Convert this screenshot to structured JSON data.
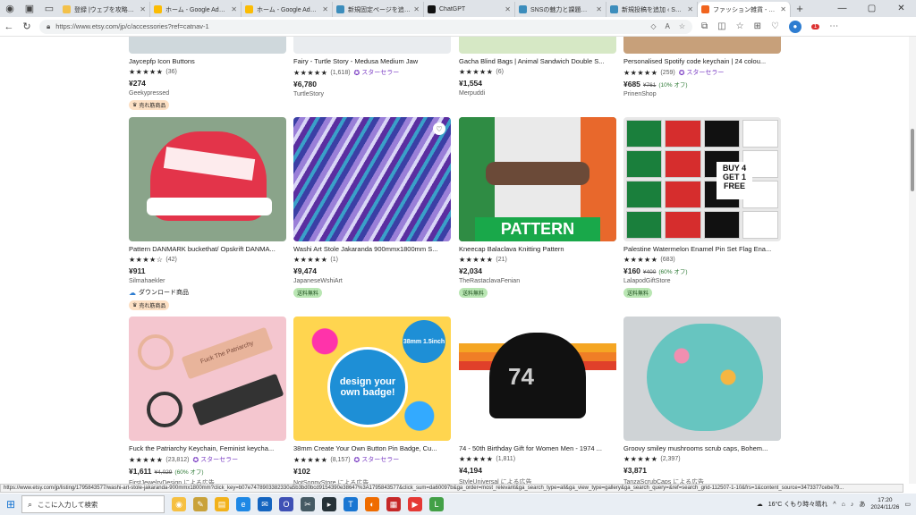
{
  "browser": {
    "tabs": [
      {
        "title": "登録 |ウェブを攻略するためのアイデア",
        "color": "#f3c14a"
      },
      {
        "title": "ホーム - Google AdSense",
        "color": "#fbbc04"
      },
      {
        "title": "ホーム - Google AdSense",
        "color": "#fbbc04"
      },
      {
        "title": "新規固定ページを追加 ‹ SNSの",
        "color": "#3c8dbc"
      },
      {
        "title": "ChatGPT",
        "color": "#111"
      },
      {
        "title": "SNSの魅力と課題：私たちの",
        "color": "#3c8dbc"
      },
      {
        "title": "新規投稿を追加 ‹ SNSの魅力",
        "color": "#3c8dbc"
      },
      {
        "title": "ファッション雑貨 - Etsy 日本",
        "color": "#f1641e"
      }
    ],
    "url": "https://www.etsy.com/jp/c/accessories?ref=catnav-1",
    "avatar_badge": "1"
  },
  "products": [
    {
      "title": "Jaycepfp Icon Buttons",
      "stars": "★★★★★",
      "reviews": "(36)",
      "star_seller": "",
      "price": "¥274",
      "orig": "",
      "disc": "",
      "shop": "Geekypressed",
      "bestseller": "売れ筋商品",
      "download": "",
      "ship": "",
      "img": "#cfd8dc"
    },
    {
      "title": "Fairy - Turtle Story - Medusa Medium Jaw",
      "stars": "★★★★★",
      "reviews": "(1,618)",
      "star_seller": "スターセラー",
      "price": "¥6,780",
      "orig": "",
      "disc": "",
      "shop": "TurtleStory",
      "bestseller": "",
      "download": "",
      "ship": "",
      "img": "#e9ecef"
    },
    {
      "title": "Gacha Blind Bags | Animal Sandwich Double S...",
      "stars": "★★★★★",
      "reviews": "(6)",
      "star_seller": "",
      "price": "¥1,554",
      "orig": "",
      "disc": "",
      "shop": "Merpuddi",
      "bestseller": "",
      "download": "",
      "ship": "",
      "img": "#d6e8c5"
    },
    {
      "title": "Personalised Spotify code keychain | 24 colou...",
      "stars": "★★★★★",
      "reviews": "(259)",
      "star_seller": "スターセラー",
      "price": "¥685",
      "orig": "¥761",
      "disc": "(10% オフ)",
      "shop": "PrinenShop",
      "bestseller": "",
      "download": "",
      "ship": "",
      "img": "#c7a07a"
    },
    {
      "title": "Pattern DANMARK buckethat/ Opskrift DANMA...",
      "stars": "★★★★☆",
      "reviews": "(42)",
      "star_seller": "",
      "price": "¥911",
      "orig": "",
      "disc": "",
      "shop": "Silmahaekler",
      "bestseller": "売れ筋商品",
      "download": "ダウンロード商品",
      "ship": "",
      "img": "danmark"
    },
    {
      "title": "Washi Art Stole Jakaranda 900mmx1800mm S...",
      "stars": "★★★★★",
      "reviews": "(1)",
      "star_seller": "",
      "price": "¥9,474",
      "orig": "",
      "disc": "",
      "shop": "JapaneseWshiArt",
      "bestseller": "",
      "download": "",
      "ship": "送料無料",
      "img": "washi"
    },
    {
      "title": "Kneecap Balaclava Knitting Pattern",
      "stars": "★★★★★",
      "reviews": "(21)",
      "star_seller": "",
      "price": "¥2,034",
      "orig": "",
      "disc": "",
      "shop": "TheRastaclavaFenian",
      "bestseller": "",
      "download": "",
      "ship": "送料無料",
      "img": "balaclava",
      "overlay": "PATTERN"
    },
    {
      "title": "Palestine Watermelon Enamel Pin Set Flag Ena...",
      "stars": "★★★★★",
      "reviews": "(683)",
      "star_seller": "",
      "price": "¥160",
      "orig": "¥400",
      "disc": "(60% オフ)",
      "shop": "LalapodGiftStore",
      "bestseller": "",
      "download": "",
      "ship": "送料無料",
      "img": "pins",
      "overlay": "BUY 4 GET 1 FREE"
    },
    {
      "title": "Fuck the Patriarchy Keychain, Feminist keycha...",
      "stars": "★★★★★",
      "reviews": "(23,812)",
      "star_seller": "スターセラー",
      "price": "¥1,611",
      "orig": "¥4,029",
      "disc": "(60% オフ)",
      "shop": "FirstJewelryDesign による広告",
      "bestseller": "",
      "download": "",
      "ship": "",
      "img": "keychain",
      "overlay": "Fuck The Patriarchy"
    },
    {
      "title": "38mm Create Your Own Button Pin Badge, Cu...",
      "stars": "★★★★★",
      "reviews": "(8,157)",
      "star_seller": "スターセラー",
      "price": "¥102",
      "orig": "",
      "disc": "",
      "shop": "NotSoppyStore による広告",
      "bestseller": "",
      "download": "",
      "ship": "",
      "img": "badge",
      "overlay": "design your own badge!",
      "overlay2": "38mm 1.5inch"
    },
    {
      "title": "74 - 50th Birthday Gift for Women Men - 1974 ...",
      "stars": "★★★★★",
      "reviews": "(1,811)",
      "star_seller": "",
      "price": "¥4,194",
      "orig": "",
      "disc": "",
      "shop": "StyleUniversal による広告",
      "bestseller": "",
      "download": "",
      "ship": "",
      "img": "cap",
      "overlay": "74"
    },
    {
      "title": "Groovy smiley mushrooms scrub caps, Bohem...",
      "stars": "★★★★★",
      "reviews": "(2,397)",
      "star_seller": "",
      "price": "¥3,871",
      "orig": "",
      "disc": "",
      "shop": "TanzaScrubCaps による広告",
      "bestseller": "",
      "download": "",
      "ship": "",
      "img": "scrub"
    }
  ],
  "status_url": "https://www.etsy.com/jp/listing/1795843577/washi-art-stole-jakaranda-900mmx1800mm?click_key=b07e7478903382330a5b3bd0bcd9154390e38647%3A1795843577&click_sum=da60097b&ga_order=most_relevant&ga_search_type=all&ga_view_type=gallery&ga_search_query=&ref=search_grid-112507-1-10&frs=1&content_source=3473377cebe79...",
  "taskbar": {
    "search_placeholder": "ここに入力して検索",
    "weather": "16°C くもり時々晴れ",
    "time": "17:20",
    "date": "2024/11/26"
  }
}
